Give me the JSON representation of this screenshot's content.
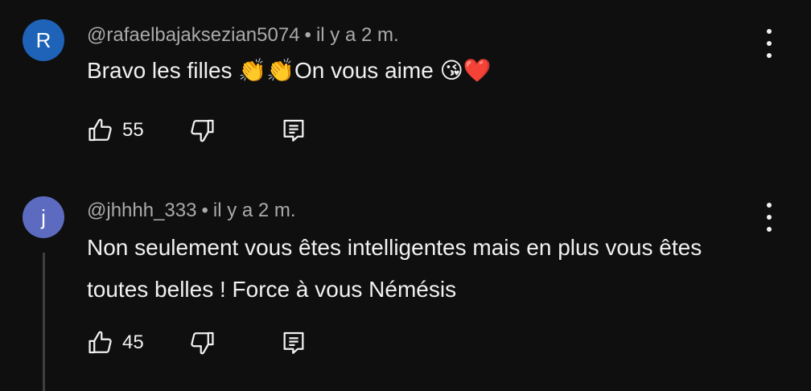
{
  "comments": [
    {
      "avatar_letter": "R",
      "avatar_color": "#1e63b8",
      "handle": "@rafaelbajaksezian5074",
      "separator": "•",
      "time": "il y a 2 m.",
      "text_part1": "Bravo les filles ",
      "emoji1": "👏👏",
      "text_part2": "On vous aime ",
      "emoji2": "😘❤️",
      "likes": "55"
    },
    {
      "avatar_letter": "j",
      "avatar_color": "#5c6bc0",
      "handle": "@jhhhh_333",
      "separator": "•",
      "time": "il y a 2 m.",
      "text": "Non seulement vous êtes intelligentes mais en plus vous êtes toutes belles ! Force à vous Némésis",
      "likes": "45"
    }
  ],
  "icons": {
    "like": "thumbs-up-icon",
    "dislike": "thumbs-down-icon",
    "reply": "reply-icon",
    "menu": "more-vert-icon"
  }
}
